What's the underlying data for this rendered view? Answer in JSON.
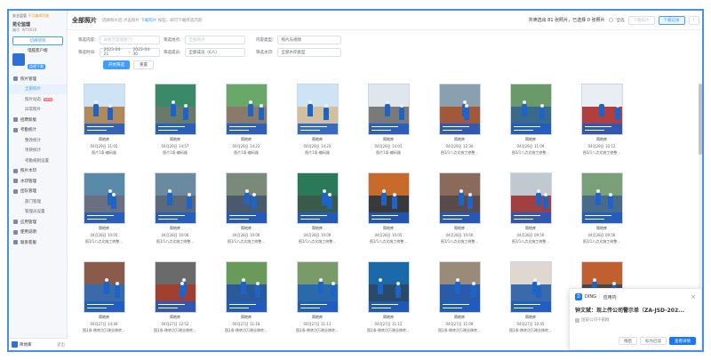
{
  "sidebar": {
    "env_label": "安全监管",
    "env_warning": "不可编辑功能",
    "project_name": "昆仑监理",
    "project_id": "编号: WT0818",
    "switch_label": "切换项目",
    "user_name": "电脑客户端",
    "user_badge": "监理下载",
    "menu": [
      {
        "label": "照片管理",
        "type": "group"
      },
      {
        "label": "全部照片",
        "type": "sub",
        "active": true
      },
      {
        "label": "照片动态",
        "type": "sub",
        "badge": "NEW"
      },
      {
        "label": "异常照片",
        "type": "sub"
      },
      {
        "label": "招聘新版",
        "type": "group"
      },
      {
        "label": "考勤统计",
        "type": "group"
      },
      {
        "label": "整改统计",
        "type": "sub"
      },
      {
        "label": "项目统计",
        "type": "sub"
      },
      {
        "label": "考勤规则设置",
        "type": "sub"
      },
      {
        "label": "照片水印",
        "type": "group"
      },
      {
        "label": "水印管理",
        "type": "group"
      },
      {
        "label": "团队管理",
        "type": "group"
      },
      {
        "label": "部门管理",
        "type": "sub"
      },
      {
        "label": "管理员设置",
        "type": "sub"
      },
      {
        "label": "应用管理",
        "type": "group"
      },
      {
        "label": "使用说明",
        "type": "group"
      },
      {
        "label": "联系客服",
        "type": "group"
      }
    ],
    "account_name": "简地库",
    "logout_label": "退出"
  },
  "header": {
    "title": "全部照片",
    "hint_prefix": "选择照片后",
    "hint_tab": "点击照片",
    "hint_link": "下载照片",
    "hint_suffix": "按钮，即可下载所选内容",
    "summary": "共筛选出 81 张照片，已选择 0 张照片",
    "select_all_label": "全选",
    "download_btn": "下载照片",
    "download_record_btn": "下载记录",
    "more_btn": "⋮"
  },
  "filters": {
    "content_label": "筛选内容:",
    "content_placeholder": "关联方案或部门",
    "location_label": "筛选地点:",
    "location_placeholder": "全部地点",
    "type_label": "内容类型:",
    "type_value": "照片与视频",
    "time_label": "筛选时间:",
    "date_start": "2023-04-21",
    "date_sep": "-",
    "date_end": "2023-04-30",
    "member_label": "筛选成员:",
    "member_value": "全部成员（6人）",
    "watermark_label": "筛选水印:",
    "watermark_value": "全部水印类型",
    "search_btn": "开始筛选",
    "reset_btn": "重置"
  },
  "photos": [
    {
      "author": "简地库",
      "time": "04月29日 11:05",
      "desc": "图片1条·编码器",
      "sky": "#cfe3f7",
      "ground": "#b08a5a"
    },
    {
      "author": "简地库",
      "time": "04月29日 14:57",
      "desc": "图片1条·编码器",
      "sky": "#3a8a6a",
      "ground": "#6a7a6a"
    },
    {
      "author": "简地库",
      "time": "04月29日 14:23",
      "desc": "图片1条·编码器",
      "sky": "#6aa86a",
      "ground": "#8a7a6a"
    },
    {
      "author": "简地库",
      "time": "04月29日 14:23",
      "desc": "图片1条·编码器",
      "sky": "#cfe3f7",
      "ground": "#d0c0a0"
    },
    {
      "author": "简地库",
      "time": "04月29日 14:01",
      "desc": "图片1条·编码器",
      "sky": "#e0e6ee",
      "ground": "#7a7a7a"
    },
    {
      "author": "简地库",
      "time": "04月29日 12:30",
      "desc": "图1/1八点文施工修整...",
      "sky": "#8aa0b0",
      "ground": "#a05a3a"
    },
    {
      "author": "简地库",
      "time": "04月29日 11:09",
      "desc": "图1/1八点文施工修整...",
      "sky": "#6a9a6a",
      "ground": "#3a6a8a"
    },
    {
      "author": "简地库",
      "time": "04月29日 10:12",
      "desc": "图1/1八点文施工修整...",
      "sky": "#e8eef4",
      "ground": "#b04040"
    },
    {
      "author": "简地库",
      "time": "04月28日 10:05",
      "desc": "图1/1八点文施工修整...",
      "sky": "#5a8aaa",
      "ground": "#6a7080"
    },
    {
      "author": "简地库",
      "time": "04月28日 10:06",
      "desc": "图1/1八点文施工修整...",
      "sky": "#6a8aa0",
      "ground": "#5a6a7a"
    },
    {
      "author": "简地库",
      "time": "04月28日 10:08",
      "desc": "图1/1八点文施工修整...",
      "sky": "#7a8a7a",
      "ground": "#4a5a6a"
    },
    {
      "author": "简地库",
      "time": "04月28日 10:08",
      "desc": "图1/1八点文施工修整...",
      "sky": "#2a7a5a",
      "ground": "#3a5a4a"
    },
    {
      "author": "简地库",
      "time": "04月28日 10:05",
      "desc": "图1/1八点文施工修整...",
      "sky": "#c86a2a",
      "ground": "#3a3a3a"
    },
    {
      "author": "简地库",
      "time": "04月28日 10:00",
      "desc": "图1/1八点文施工修整...",
      "sky": "#8a6a5a",
      "ground": "#5a4a4a"
    },
    {
      "author": "简地库",
      "time": "04月28日 09:59",
      "desc": "图1/1八点文施工修整...",
      "sky": "#c0c8d0",
      "ground": "#a04040"
    },
    {
      "author": "简地库",
      "time": "04月28日 09:58",
      "desc": "图1/1八点文施工修整...",
      "sky": "#7aa07a",
      "ground": "#4a6a8a"
    },
    {
      "author": "简地库",
      "time": "04月27日 14:40",
      "desc": "图1条·移转功万建业移转...",
      "sky": "#8a5a4a",
      "ground": "#3a6aaa"
    },
    {
      "author": "简地库",
      "time": "04月27日 12:52",
      "desc": "图1条·移转功万建业移转...",
      "sky": "#6a6a6a",
      "ground": "#a04030"
    },
    {
      "author": "简地库",
      "time": "04月27日 11:18",
      "desc": "图1条·移转功万建业移转...",
      "sky": "#6a9a5a",
      "ground": "#2a5a9a"
    },
    {
      "author": "简地库",
      "time": "04月27日 11:13",
      "desc": "图1条·移转功万建业移转...",
      "sky": "#7a9a6a",
      "ground": "#2a6aaa"
    },
    {
      "author": "简地库",
      "time": "04月27日 11:12",
      "desc": "图1条·移转功万建业移转...",
      "sky": "#1a6aaa",
      "ground": "#2a4a6a"
    },
    {
      "author": "简地库",
      "time": "04月27日 11:09",
      "desc": "图1条·移转功万建业移转...",
      "sky": "#9a8a7a",
      "ground": "#2a5aaa"
    },
    {
      "author": "简地库",
      "time": "04月27日 10:45",
      "desc": "图1条·移转功万建业移转...",
      "sky": "#e0d8d0",
      "ground": "#3a6aaa"
    },
    {
      "author": "简地库",
      "time": "04月27日 10:43",
      "desc": "图1条·移转功万建业移转...",
      "sky": "#c06030",
      "ground": "#4a4a4a"
    }
  ],
  "notification": {
    "app": "DING",
    "context": "应用内",
    "title": "钟文斌：现上传公司警示单（ZA-JSD-202...",
    "org": "国安公司千部群",
    "later_btn": "稍后",
    "read_btn": "标为已读",
    "detail_btn": "查看详情",
    "close": "×"
  }
}
